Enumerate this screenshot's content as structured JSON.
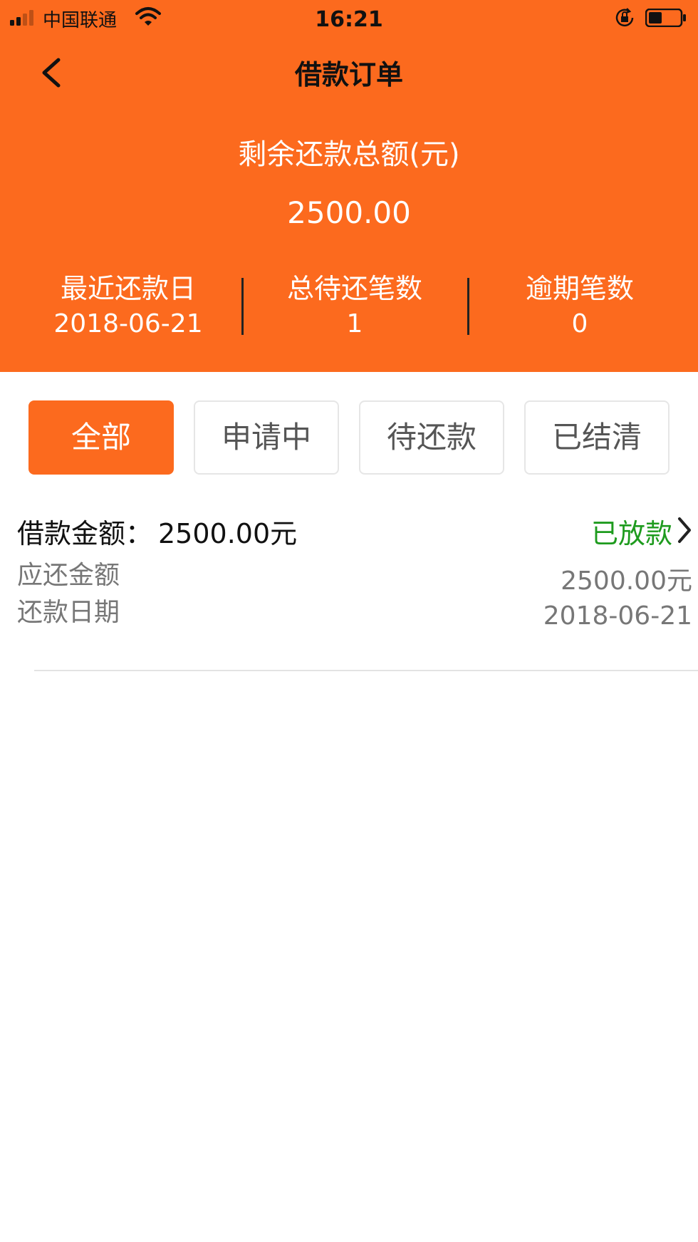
{
  "status_bar": {
    "carrier": "中国联通",
    "time": "16:21",
    "signal_bars": 4,
    "icons": [
      "signal-icon",
      "wifi-icon",
      "rotation-lock-icon",
      "battery-icon"
    ]
  },
  "nav": {
    "title": "借款订单",
    "back_icon": "chevron-left-icon"
  },
  "summary": {
    "label": "剩余还款总额(元)",
    "amount": "2500.00",
    "stats": [
      {
        "label": "最近还款日",
        "value": "2018-06-21"
      },
      {
        "label": "总待还笔数",
        "value": "1"
      },
      {
        "label": "逾期笔数",
        "value": "0"
      }
    ]
  },
  "tabs": [
    {
      "label": "全部",
      "active": true
    },
    {
      "label": "申请中",
      "active": false
    },
    {
      "label": "待还款",
      "active": false
    },
    {
      "label": "已结清",
      "active": false
    }
  ],
  "orders": [
    {
      "loan_label": "借款金额：",
      "loan_amount": "2500.00元",
      "status": "已放款",
      "rows": [
        {
          "label": "应还金额",
          "value": "2500.00元"
        },
        {
          "label": "还款日期",
          "value": "2018-06-21"
        }
      ]
    }
  ],
  "colors": {
    "primary": "#FC6A1E",
    "status_green": "#1E9B1E",
    "text_dark": "#111111",
    "text_muted": "#777777"
  }
}
